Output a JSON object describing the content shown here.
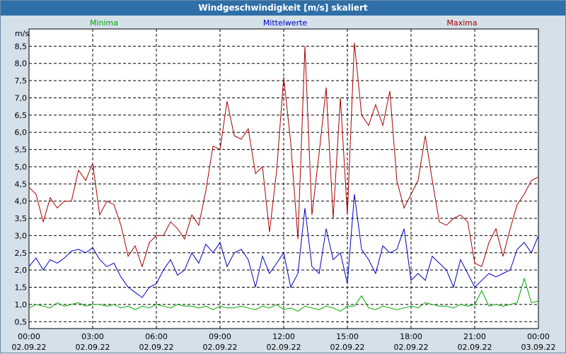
{
  "chart_data": {
    "type": "line",
    "title": "Windgeschwindigkeit [m/s] skaliert",
    "ylabel": "m/s",
    "ylim": [
      0.3,
      9.0
    ],
    "xlim": [
      0,
      24
    ],
    "grid": true,
    "yticks": [
      "0,5",
      "1,0",
      "1,5",
      "2,0",
      "2,5",
      "3,0",
      "3,5",
      "4,0",
      "4,5",
      "5,0",
      "5,5",
      "6,0",
      "6,5",
      "7,0",
      "7,5",
      "8,0",
      "8,5"
    ],
    "ytick_values": [
      0.5,
      1.0,
      1.5,
      2.0,
      2.5,
      3.0,
      3.5,
      4.0,
      4.5,
      5.0,
      5.5,
      6.0,
      6.5,
      7.0,
      7.5,
      8.0,
      8.5
    ],
    "xticks": [
      {
        "time": "00:00",
        "date": "02.09.22"
      },
      {
        "time": "03:00",
        "date": "02.09.22"
      },
      {
        "time": "06:00",
        "date": "02.09.22"
      },
      {
        "time": "09:00",
        "date": "02.09.22"
      },
      {
        "time": "12:00",
        "date": "02.09.22"
      },
      {
        "time": "15:00",
        "date": "02.09.22"
      },
      {
        "time": "18:00",
        "date": "02.09.22"
      },
      {
        "time": "21:00",
        "date": "02.09.22"
      },
      {
        "time": "00:00",
        "date": "03.09.22"
      }
    ],
    "x_hours": [
      0,
      0.33,
      0.67,
      1,
      1.33,
      1.67,
      2,
      2.33,
      2.67,
      3,
      3.33,
      3.67,
      4,
      4.33,
      4.67,
      5,
      5.33,
      5.67,
      6,
      6.33,
      6.67,
      7,
      7.33,
      7.67,
      8,
      8.33,
      8.67,
      9,
      9.33,
      9.67,
      10,
      10.33,
      10.67,
      11,
      11.33,
      11.67,
      12,
      12.33,
      12.67,
      13,
      13.33,
      13.67,
      14,
      14.33,
      14.67,
      15,
      15.33,
      15.67,
      16,
      16.33,
      16.67,
      17,
      17.33,
      17.67,
      18,
      18.33,
      18.67,
      19,
      19.33,
      19.67,
      20,
      20.33,
      20.67,
      21,
      21.33,
      21.67,
      22,
      22.33,
      22.67,
      23,
      23.33,
      23.67,
      24
    ],
    "series": [
      {
        "name": "Minima",
        "color": "#00aa00",
        "values": [
          0.9,
          1.0,
          0.95,
          0.9,
          1.05,
          0.95,
          1.0,
          1.05,
          0.95,
          1.0,
          1.0,
          0.95,
          1.0,
          0.9,
          0.95,
          0.85,
          0.95,
          0.9,
          1.0,
          0.95,
          0.9,
          1.0,
          0.95,
          0.95,
          0.9,
          0.95,
          0.85,
          0.95,
          0.9,
          0.9,
          0.95,
          0.9,
          0.85,
          0.95,
          0.9,
          1.0,
          0.85,
          0.9,
          0.8,
          0.95,
          0.9,
          0.85,
          0.95,
          0.9,
          0.8,
          0.95,
          0.95,
          1.25,
          0.9,
          0.85,
          0.95,
          0.9,
          0.85,
          0.9,
          0.95,
          0.9,
          1.05,
          1.0,
          0.95,
          0.95,
          0.9,
          1.0,
          0.95,
          1.0,
          1.4,
          0.95,
          1.0,
          0.95,
          1.0,
          1.05,
          1.75,
          1.05,
          1.1
        ]
      },
      {
        "name": "Mittelwerte",
        "color": "#0000c0",
        "values": [
          2.1,
          2.35,
          2.0,
          2.3,
          2.2,
          2.35,
          2.55,
          2.6,
          2.5,
          2.65,
          2.3,
          2.1,
          2.2,
          1.8,
          1.5,
          1.35,
          1.2,
          1.5,
          1.6,
          2.0,
          2.3,
          1.85,
          2.0,
          2.5,
          2.2,
          2.75,
          2.5,
          2.8,
          2.1,
          2.5,
          2.6,
          2.3,
          1.5,
          2.4,
          1.9,
          2.2,
          2.5,
          1.5,
          1.9,
          3.8,
          2.1,
          1.9,
          3.2,
          2.3,
          2.5,
          1.6,
          4.2,
          2.6,
          2.3,
          1.9,
          2.7,
          2.5,
          2.6,
          3.2,
          1.7,
          1.9,
          1.7,
          2.4,
          2.2,
          2.0,
          1.5,
          2.3,
          1.9,
          1.5,
          1.7,
          1.9,
          1.8,
          1.9,
          2.0,
          2.6,
          2.8,
          2.5,
          3.0
        ]
      },
      {
        "name": "Maxima",
        "color": "#aa0000",
        "values": [
          4.4,
          4.2,
          3.4,
          4.1,
          3.8,
          4.0,
          4.0,
          4.9,
          4.6,
          5.1,
          3.6,
          4.0,
          3.9,
          3.3,
          2.4,
          2.7,
          2.1,
          2.8,
          3.0,
          3.0,
          3.4,
          3.2,
          2.9,
          3.6,
          3.3,
          4.3,
          5.6,
          5.5,
          6.9,
          5.9,
          5.8,
          6.1,
          4.8,
          5.0,
          3.1,
          4.9,
          7.6,
          5.7,
          2.9,
          8.5,
          3.6,
          5.4,
          7.3,
          3.5,
          7.0,
          3.6,
          8.6,
          6.5,
          6.2,
          6.8,
          6.2,
          7.2,
          4.6,
          3.8,
          4.2,
          4.6,
          5.9,
          4.6,
          3.4,
          3.3,
          3.5,
          3.6,
          3.4,
          2.2,
          2.1,
          2.8,
          3.2,
          2.4,
          3.2,
          3.9,
          4.2,
          4.6,
          4.7
        ]
      }
    ]
  }
}
